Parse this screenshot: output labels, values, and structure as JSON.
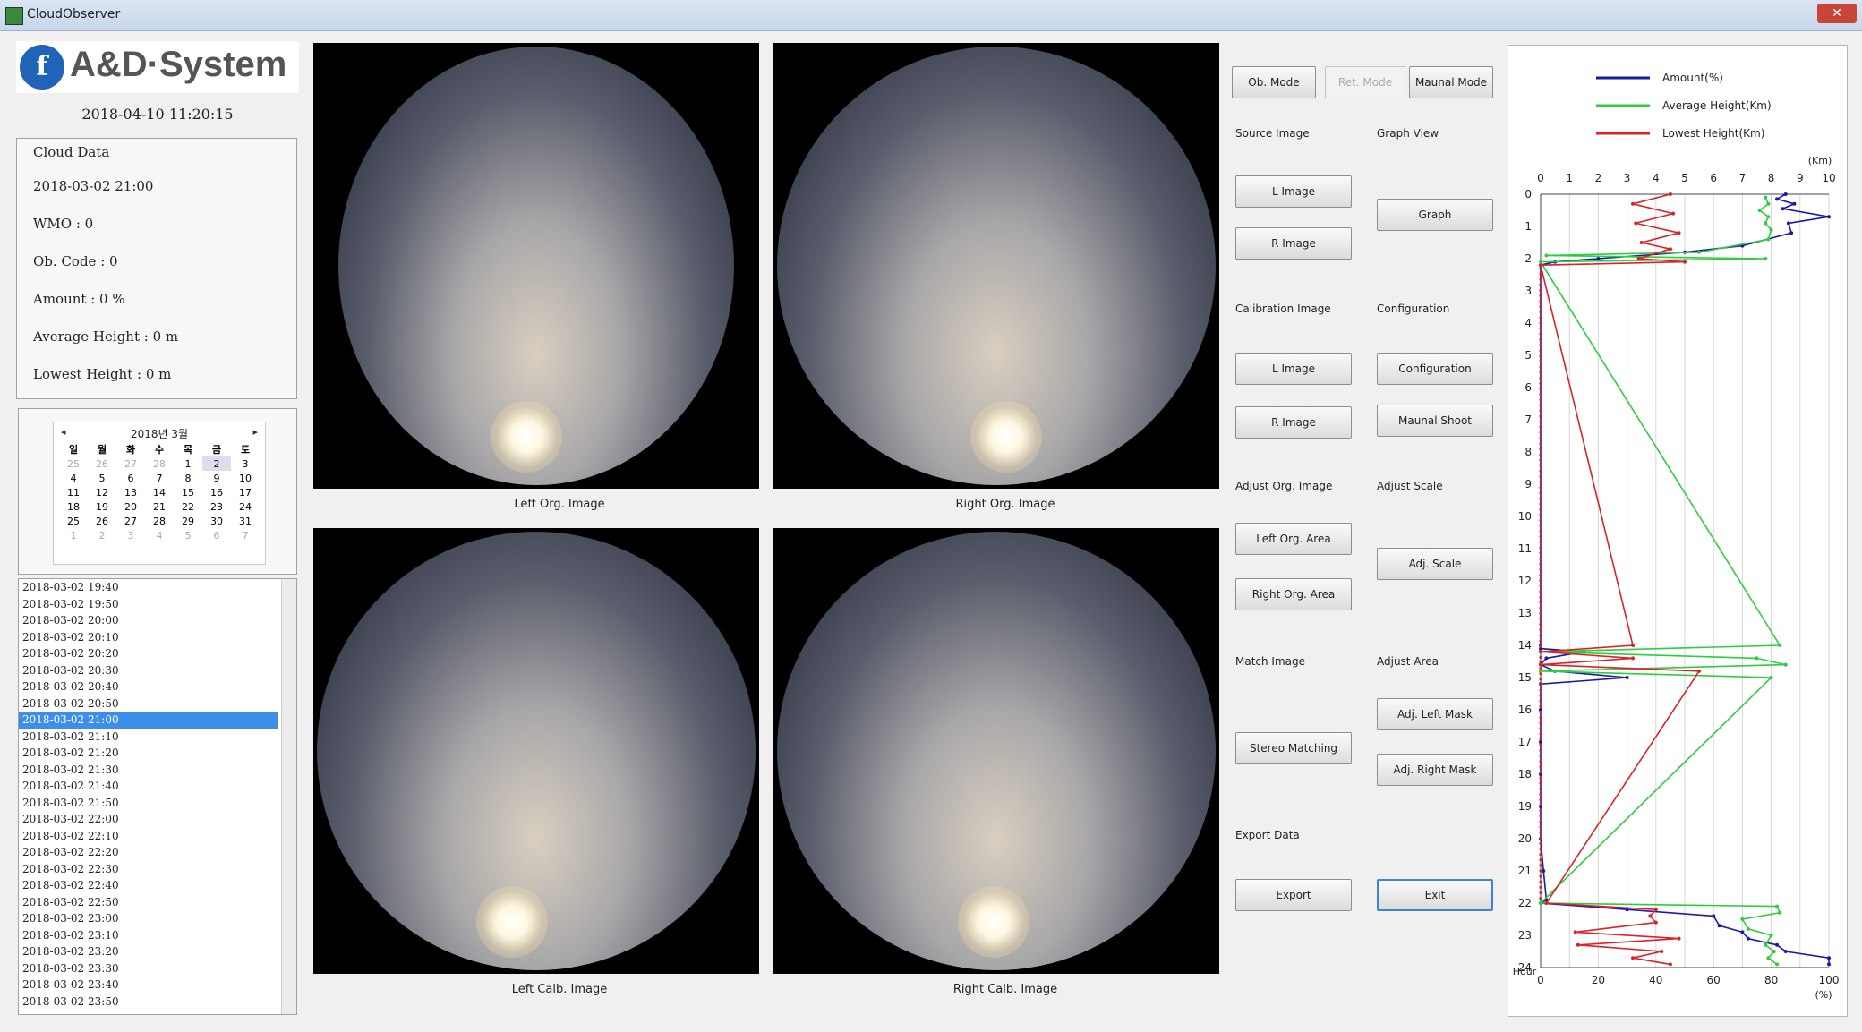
{
  "window": {
    "title": "CloudObserver"
  },
  "brand": {
    "logo_mark": "f",
    "logo_text": "A&D·System"
  },
  "datetime": "2018-04-10 11:20:15",
  "cloud_data": {
    "title": "Cloud Data",
    "datetime": "2018-03-02 21:00",
    "wmo": "WMO : 0",
    "ob_code": "Ob. Code : 0",
    "amount": "Amount : 0 %",
    "avg_height": "Average Height : 0 m",
    "lowest_height": "Lowest Height : 0 m"
  },
  "calendar": {
    "month_label": "2018년 3월",
    "prev": "◂",
    "next": "▸",
    "dow": [
      "일",
      "월",
      "화",
      "수",
      "목",
      "금",
      "토"
    ],
    "weeks": [
      [
        "25",
        "26",
        "27",
        "28",
        "1",
        "2",
        "3"
      ],
      [
        "4",
        "5",
        "6",
        "7",
        "8",
        "9",
        "10"
      ],
      [
        "11",
        "12",
        "13",
        "14",
        "15",
        "16",
        "17"
      ],
      [
        "18",
        "19",
        "20",
        "21",
        "22",
        "23",
        "24"
      ],
      [
        "25",
        "26",
        "27",
        "28",
        "29",
        "30",
        "31"
      ],
      [
        "1",
        "2",
        "3",
        "4",
        "5",
        "6",
        "7"
      ]
    ]
  },
  "time_list": [
    "2018-03-02 19:40",
    "2018-03-02 19:50",
    "2018-03-02 20:00",
    "2018-03-02 20:10",
    "2018-03-02 20:20",
    "2018-03-02 20:30",
    "2018-03-02 20:40",
    "2018-03-02 20:50",
    "2018-03-02 21:00",
    "2018-03-02 21:10",
    "2018-03-02 21:20",
    "2018-03-02 21:30",
    "2018-03-02 21:40",
    "2018-03-02 21:50",
    "2018-03-02 22:00",
    "2018-03-02 22:10",
    "2018-03-02 22:20",
    "2018-03-02 22:30",
    "2018-03-02 22:40",
    "2018-03-02 22:50",
    "2018-03-02 23:00",
    "2018-03-02 23:10",
    "2018-03-02 23:20",
    "2018-03-02 23:30",
    "2018-03-02 23:40",
    "2018-03-02 23:50"
  ],
  "selected_time": "2018-03-02 21:00",
  "images": {
    "left_org": "Left Org. Image",
    "right_org": "Right Org. Image",
    "left_calb": "Left Calb. Image",
    "right_calb": "Right Calb. Image"
  },
  "modes": {
    "ob": "Ob. Mode",
    "ret": "Ret. Mode",
    "manual": "Maunal Mode"
  },
  "sections": {
    "source_image": "Source Image",
    "graph_view": "Graph View",
    "calibration_image": "Calibration Image",
    "configuration": "Configuration",
    "adjust_org_image": "Adjust Org. Image",
    "adjust_scale": "Adjust Scale",
    "match_image": "Match Image",
    "adjust_area": "Adjust Area",
    "export_data": "Export Data"
  },
  "buttons": {
    "src_l_image": "L Image",
    "src_r_image": "R Image",
    "graph": "Graph",
    "calib_l_image": "L Image",
    "calib_r_image": "R Image",
    "configuration": "Configuration",
    "manual_shoot": "Maunal Shoot",
    "left_org_area": "Left Org. Area",
    "right_org_area": "Right Org. Area",
    "adj_scale": "Adj. Scale",
    "stereo_matching": "Stereo Matching",
    "adj_left_mask": "Adj. Left Mask",
    "adj_right_mask": "Adj. Right Mask",
    "export": "Export",
    "exit": "Exit"
  },
  "chart_data": {
    "type": "line",
    "legend": [
      {
        "name": "Amount(%)",
        "color": "#1a1aa8"
      },
      {
        "name": "Average Height(Km)",
        "color": "#2ecc40"
      },
      {
        "name": "Lowest Height(Km)",
        "color": "#d9222a"
      }
    ],
    "top_axis": {
      "label": "(Km)",
      "ticks": [
        "0",
        "1",
        "2",
        "3",
        "4",
        "5",
        "6",
        "7",
        "8",
        "9",
        "10"
      ],
      "range": [
        0,
        10
      ]
    },
    "bottom_axis": {
      "label": "(%)",
      "ticks": [
        "0",
        "20",
        "40",
        "60",
        "80",
        "100"
      ],
      "range": [
        0,
        100
      ]
    },
    "y_axis": {
      "label": "Hour",
      "ticks": [
        "0",
        "1",
        "2",
        "3",
        "4",
        "5",
        "6",
        "7",
        "8",
        "9",
        "10",
        "11",
        "12",
        "13",
        "14",
        "15",
        "16",
        "17",
        "18",
        "19",
        "20",
        "21",
        "22",
        "23",
        "24"
      ],
      "range": [
        0,
        24
      ]
    },
    "series": [
      {
        "name": "Amount(%)",
        "color": "#1a1aa8",
        "x": [
          85,
          82,
          88,
          84,
          100,
          86,
          87,
          70,
          50,
          20,
          5,
          0,
          0,
          0,
          15,
          2,
          0,
          5,
          30,
          0,
          0,
          0,
          0,
          0,
          0,
          1,
          2,
          0,
          30,
          60,
          62,
          70,
          72,
          82,
          85,
          100,
          100
        ],
        "y": [
          0,
          0.15,
          0.3,
          0.45,
          0.7,
          0.9,
          1.2,
          1.6,
          1.8,
          2.0,
          2.1,
          2.2,
          14,
          14.1,
          14.2,
          14.4,
          14.6,
          14.8,
          15,
          15.2,
          16,
          17,
          18,
          19,
          20,
          21,
          21.9,
          22,
          22.2,
          22.4,
          22.7,
          22.9,
          23.1,
          23.3,
          23.5,
          23.7,
          23.9
        ]
      },
      {
        "name": "Average Height(Km)",
        "color": "#2ecc40",
        "x": [
          7.8,
          7.9,
          7.6,
          7.9,
          7.8,
          8.0,
          7.9,
          5.5,
          0.2,
          7.8,
          0,
          8.3,
          0,
          7.5,
          8.5,
          0,
          8.0,
          0,
          8.2,
          8.3,
          7.0,
          7.2,
          8.0,
          7.8,
          8.1,
          7.9,
          8.2
        ],
        "y": [
          0.1,
          0.3,
          0.5,
          0.7,
          0.9,
          1.1,
          1.4,
          1.8,
          1.9,
          2.0,
          2.1,
          14.0,
          14.2,
          14.4,
          14.6,
          14.8,
          15.0,
          22.0,
          22.1,
          22.3,
          22.5,
          22.8,
          23.0,
          23.3,
          23.5,
          23.7,
          23.9
        ]
      },
      {
        "name": "Lowest Height(Km)",
        "color": "#d9222a",
        "x": [
          4.5,
          3.2,
          4.6,
          3.3,
          4.8,
          3.5,
          4.5,
          3.4,
          5.0,
          0,
          3.2,
          0,
          3.2,
          0,
          5.5,
          0.2,
          4.0,
          3.8,
          4.0,
          1.2,
          4.8,
          1.3,
          4.2,
          3.2,
          4.5
        ],
        "y": [
          0,
          0.3,
          0.6,
          0.9,
          1.2,
          1.5,
          1.7,
          2.0,
          2.1,
          2.2,
          14,
          14.2,
          14.4,
          14.6,
          14.8,
          22,
          22.2,
          22.4,
          22.6,
          22.9,
          23.1,
          23.3,
          23.5,
          23.7,
          23.9
        ]
      }
    ]
  }
}
